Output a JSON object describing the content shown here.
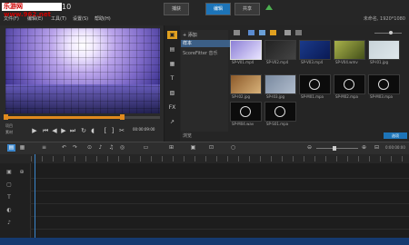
{
  "watermark": "乐游网 www.962.net",
  "app_version": "10",
  "tabs": [
    "捕获",
    "编辑",
    "共享"
  ],
  "menus": [
    "文件(F)",
    "编辑(E)",
    "工具(T)",
    "设置(S)",
    "帮助(H)"
  ],
  "project_info": "未命名, 1920*1080",
  "preview": {
    "scrub_progress": 0.75,
    "timecode": "00:00:09:00",
    "labels": {
      "project": "项目",
      "clip": "素材"
    }
  },
  "colors": {
    "accent": "#1d74b8",
    "scrub": "#e08a1e",
    "upload": "#4caf50"
  },
  "library": {
    "add_label": "添加",
    "sample_folder": "样本",
    "custom_folder": "ScoreFitter 音乐",
    "browse_label": "浏览",
    "options_label": "选项",
    "items": [
      {
        "name": "SP-V01.mp4",
        "kind": "video",
        "colors": [
          "#8c7fd6",
          "#e9e4ff"
        ]
      },
      {
        "name": "SP-V02.mp4",
        "kind": "video",
        "colors": [
          "#222",
          "#444"
        ]
      },
      {
        "name": "SP-V03.mp4",
        "kind": "video",
        "colors": [
          "#1a3a8a",
          "#0a1a55"
        ]
      },
      {
        "name": "SP-V04.wmv",
        "kind": "video",
        "colors": [
          "#a9b24a",
          "#44501a"
        ]
      },
      {
        "name": "SP-I01.jpg",
        "kind": "image",
        "colors": [
          "#c8d3d9",
          "#dfe7eb"
        ]
      },
      {
        "name": "SP-I02.jpg",
        "kind": "image",
        "colors": [
          "#8c5a2a",
          "#d8b27a"
        ]
      },
      {
        "name": "SP-I03.jpg",
        "kind": "image",
        "colors": [
          "#7a8aa0",
          "#b0bccc"
        ]
      },
      {
        "name": "SP-M01.mpa",
        "kind": "audio"
      },
      {
        "name": "SP-M02.mpa",
        "kind": "audio"
      },
      {
        "name": "SP-M03.mpa",
        "kind": "audio"
      },
      {
        "name": "SP-M04.wav",
        "kind": "audio"
      },
      {
        "name": "SP-S01.mpa",
        "kind": "audio"
      }
    ]
  }
}
